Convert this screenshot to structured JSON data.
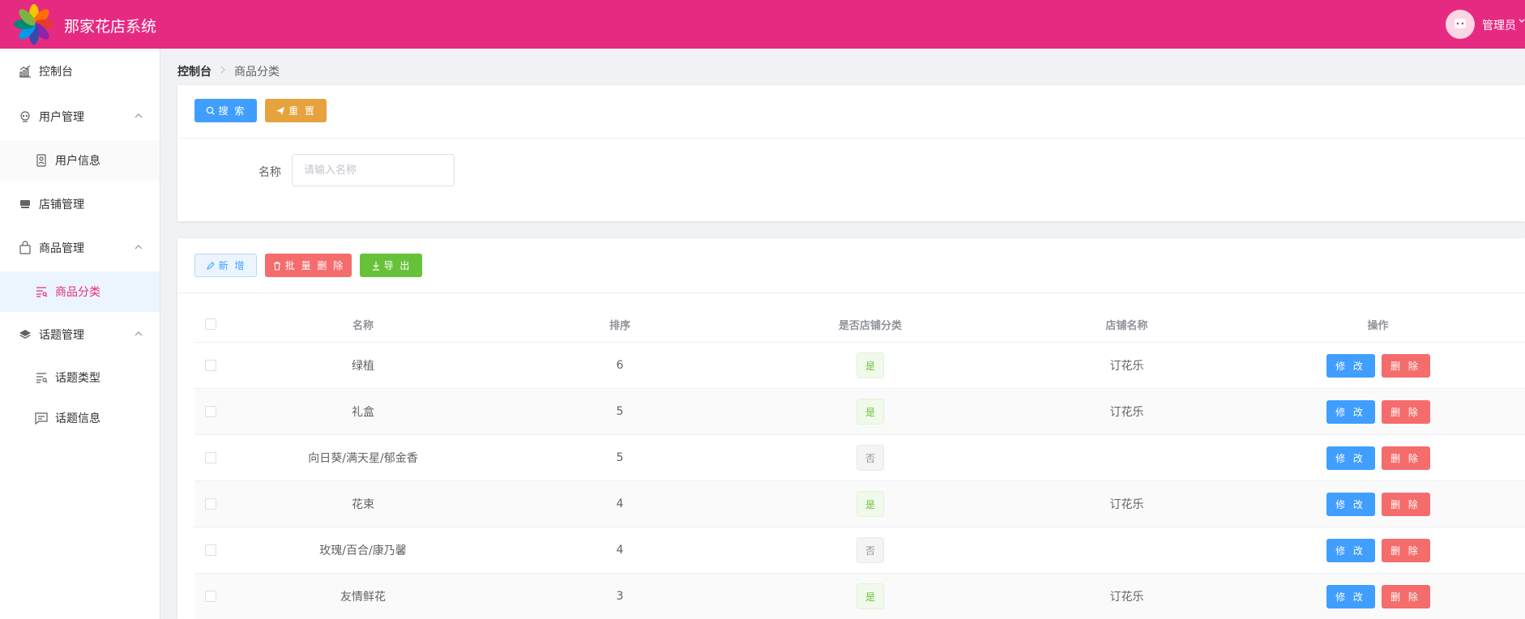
{
  "header": {
    "title": "那家花店系统",
    "user_name": "管理员",
    "brand_color": "#e62a82"
  },
  "sidebar": {
    "items": [
      {
        "label": "控制台",
        "icon": "chart-icon"
      },
      {
        "label": "用户管理",
        "icon": "user-icon",
        "expanded": true
      },
      {
        "label": "用户信息",
        "icon": "user-card-icon"
      },
      {
        "label": "店铺管理",
        "icon": "store-icon"
      },
      {
        "label": "商品管理",
        "icon": "shopping-bag-icon",
        "expanded": true
      },
      {
        "label": "商品分类",
        "icon": "list-icon",
        "active": true
      },
      {
        "label": "话题管理",
        "icon": "layers-icon",
        "expanded": true
      },
      {
        "label": "话题类型",
        "icon": "list-icon"
      },
      {
        "label": "话题信息",
        "icon": "message-icon"
      }
    ]
  },
  "breadcrumb": {
    "first": "控制台",
    "current": "商品分类"
  },
  "search_card": {
    "search_label": "搜 索",
    "reset_label": "重 置",
    "field_label": "名称",
    "field_placeholder": "请输入名称",
    "field_value": ""
  },
  "toolbar": {
    "add_label": "新 增",
    "batch_delete_label": "批 量 删 除",
    "export_label": "导 出"
  },
  "table": {
    "columns": [
      "名称",
      "排序",
      "是否店铺分类",
      "店铺名称",
      "操作"
    ],
    "rows": [
      {
        "name": "绿植",
        "sort": "6",
        "is_shop": "是",
        "shop": "订花乐"
      },
      {
        "name": "礼盒",
        "sort": "5",
        "is_shop": "是",
        "shop": "订花乐"
      },
      {
        "name": "向日葵/满天星/郁金香",
        "sort": "5",
        "is_shop": "否",
        "shop": ""
      },
      {
        "name": "花束",
        "sort": "4",
        "is_shop": "是",
        "shop": "订花乐"
      },
      {
        "name": "玫瑰/百合/康乃馨",
        "sort": "4",
        "is_shop": "否",
        "shop": ""
      },
      {
        "name": "友情鲜花",
        "sort": "3",
        "is_shop": "是",
        "shop": "订花乐"
      }
    ],
    "edit_label": "修 改",
    "delete_label": "删 除"
  }
}
